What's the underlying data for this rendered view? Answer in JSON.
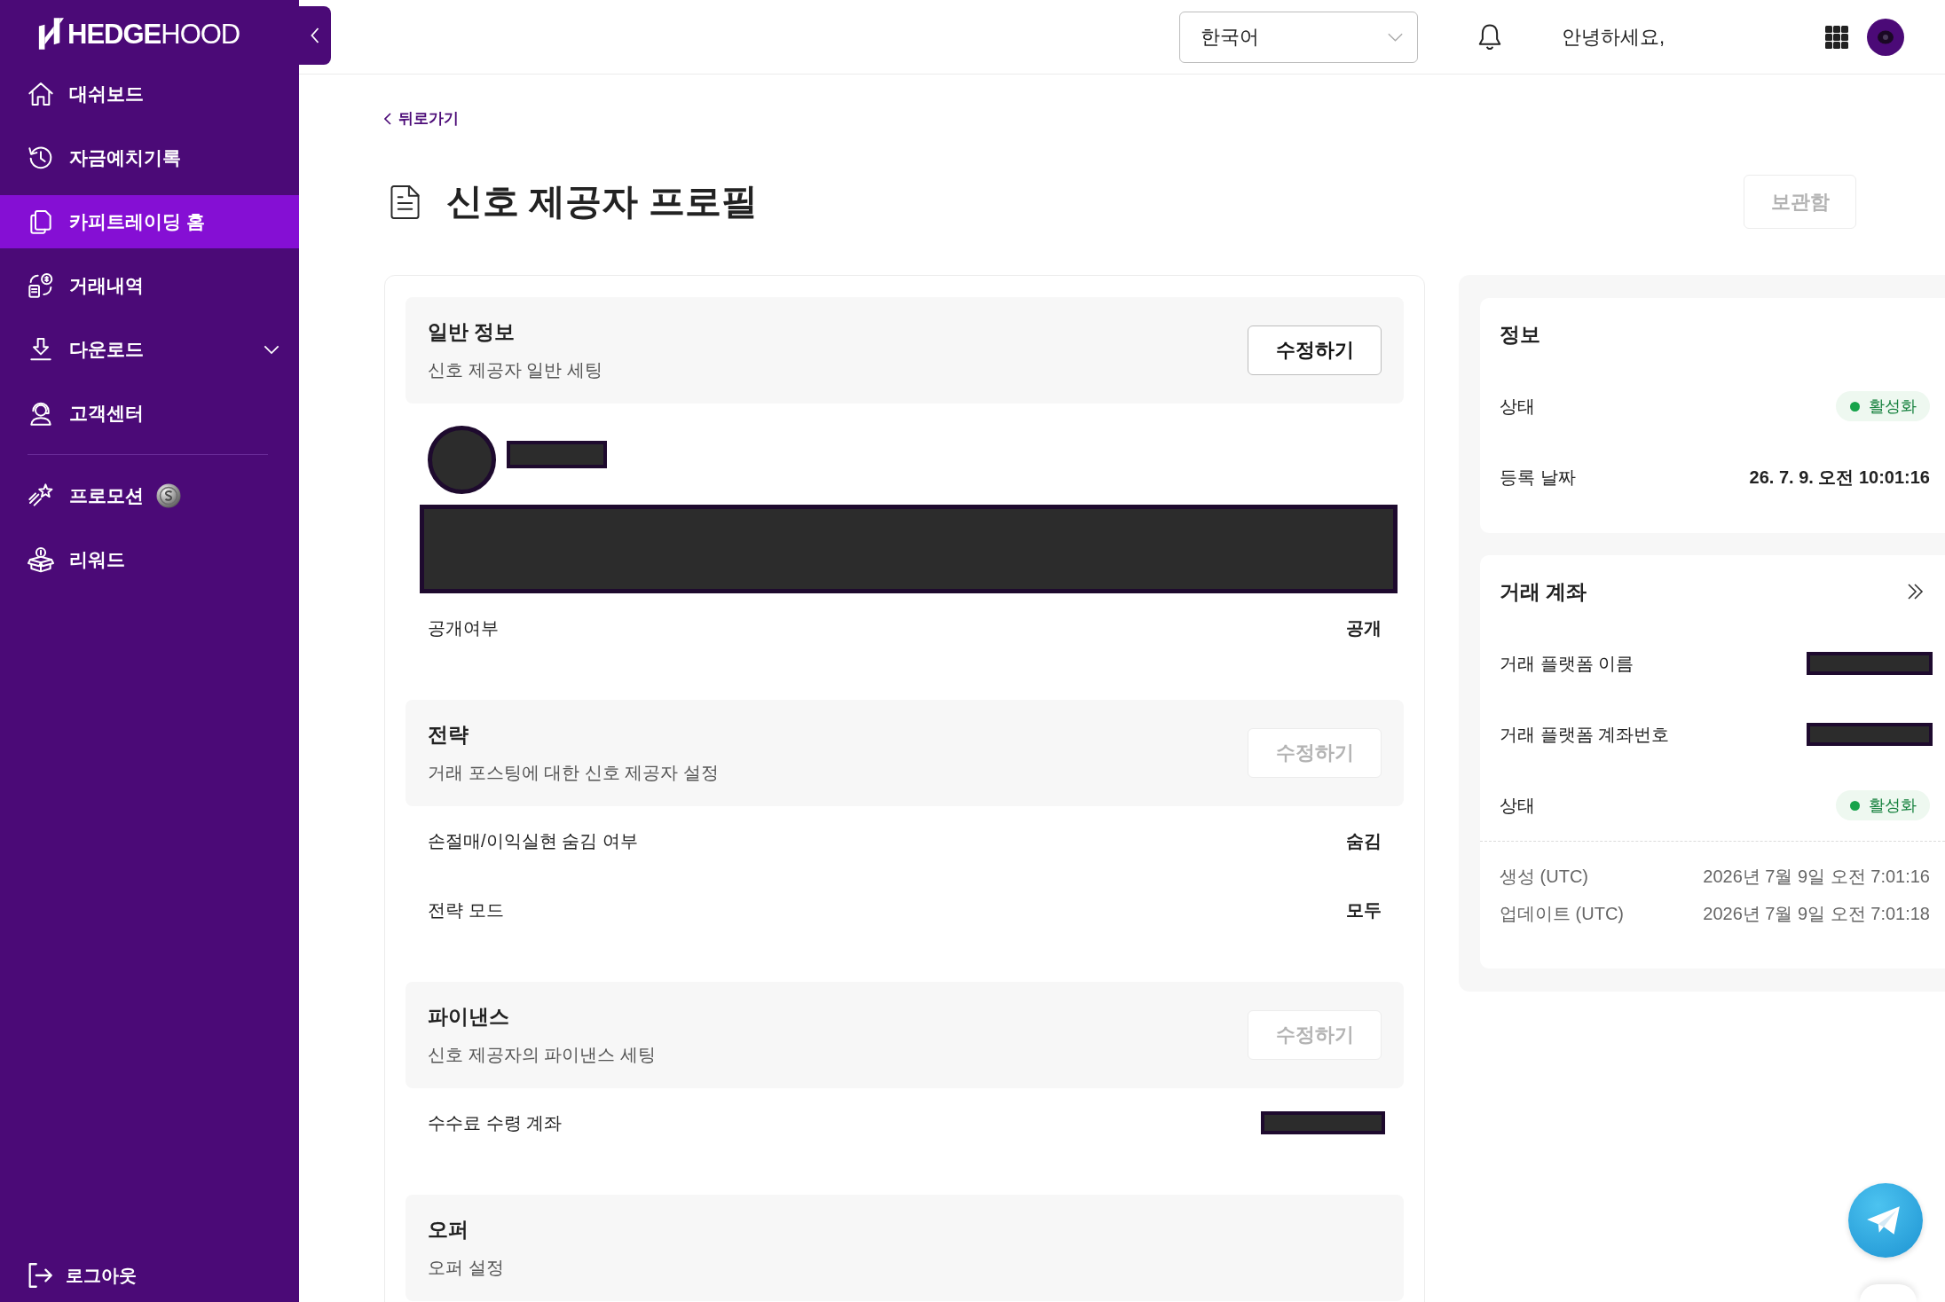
{
  "sidebar": {
    "logo": "**HEDGE**HOOD",
    "nav_groups": [
      {
        "items": [
          {
            "label": "대쉬보드",
            "kind": "link",
            "selected": false
          },
          {
            "label": "자금예치기록",
            "kind": "link",
            "selected": false
          },
          {
            "label": "카피트레이딩 홈",
            "kind": "link",
            "selected": true
          },
          {
            "label": "거래내역",
            "kind": "link",
            "selected": false
          },
          {
            "label": "다운로드",
            "kind": "group",
            "expanded": false,
            "selected": false
          },
          {
            "label": "고객센터",
            "kind": "link",
            "selected": false
          }
        ]
      },
      {
        "items": [
          {
            "label": "프로모션",
            "kind": "promo",
            "selected": false
          },
          {
            "label": "리워드",
            "kind": "link",
            "selected": false
          }
        ]
      }
    ],
    "logout": "로그아웃"
  },
  "header": {
    "language": "한국어",
    "greeting": "안녕하세요,"
  },
  "page": {
    "back_link": "뒤로가기",
    "title": "신호 제공자 프로필",
    "archive_button": {
      "label": "보관함",
      "disabled": true
    },
    "sections": [
      {
        "title": "일반 정보",
        "subtitle": "신호 제공자 일반 세팅",
        "edit_button": {
          "label": "수정하기",
          "disabled": false
        },
        "rows": [
          {
            "kind": "profile"
          },
          {
            "kind": "text",
            "label": "공개여부",
            "value": "공개"
          }
        ]
      },
      {
        "title": "전략",
        "subtitle": "거래 포스팅에 대한 신호 제공자 설정",
        "edit_button": {
          "label": "수정하기",
          "disabled": true
        },
        "rows": [
          {
            "kind": "text",
            "label": "손절매/이익실현 숨김 여부",
            "value": "숨김"
          },
          {
            "kind": "text",
            "label": "전략 모드",
            "value": "모두"
          }
        ]
      },
      {
        "title": "파이낸스",
        "subtitle": "신호 제공자의 파이낸스 세팅",
        "edit_button": {
          "label": "수정하기",
          "disabled": true
        },
        "rows": [
          {
            "kind": "redacted",
            "label": "수수료 수령 계좌"
          }
        ]
      },
      {
        "title": "오퍼",
        "subtitle": "오퍼 설정"
      }
    ]
  },
  "side_panel": {
    "cards": [
      {
        "title": "정보",
        "kind": "plain",
        "rows": [
          {
            "kind": "status",
            "label": "상태",
            "value": "활성화"
          },
          {
            "kind": "text",
            "label": "등록 날짜",
            "value": "26. 7. 9. 오전 10:01:16"
          }
        ]
      },
      {
        "title": "거래 계좌",
        "kind": "link",
        "rows": [
          {
            "kind": "redacted",
            "label": "거래 플랫폼 이름"
          },
          {
            "kind": "redacted",
            "label": "거래 플랫폼 계좌번호"
          },
          {
            "kind": "status",
            "label": "상태",
            "value": "활성화"
          }
        ],
        "timestamps": [
          {
            "label": "생성 (UTC)",
            "value": "2026년 7월 9일 오전 7:01:16"
          },
          {
            "label": "업데이트 (UTC)",
            "value": "2026년 7월 9일 오전 7:01:18"
          }
        ]
      }
    ]
  }
}
